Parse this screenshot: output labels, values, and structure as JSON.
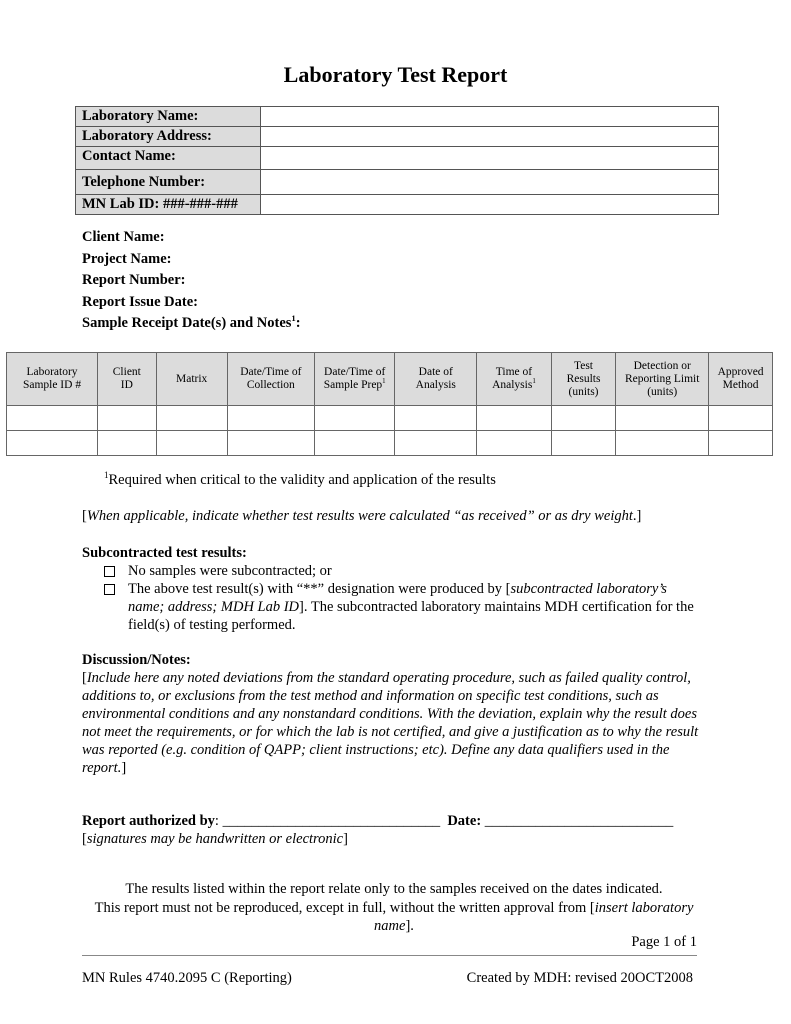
{
  "title": "Laboratory Test Report",
  "lab_info": [
    {
      "label": "Laboratory Name:",
      "value": ""
    },
    {
      "label": "Laboratory Address:",
      "value": ""
    },
    {
      "label": "Contact Name:",
      "value": ""
    },
    {
      "label": "Telephone Number:",
      "value": ""
    },
    {
      "label": "MN Lab ID: ###-###-###",
      "value": ""
    }
  ],
  "fields": {
    "client_name": "Client Name:",
    "project_name": "Project Name:",
    "report_number": "Report Number:",
    "report_issue_date": "Report Issue Date:",
    "sample_receipt": "Sample Receipt Date(s) and Notes",
    "sample_receipt_sup": "1",
    "sample_receipt_colon": ":"
  },
  "samples_table": {
    "headers": [
      {
        "l1": "Laboratory",
        "l2": "Sample ID #",
        "l3": "",
        "sup": ""
      },
      {
        "l1": "Client",
        "l2": "ID",
        "l3": "",
        "sup": ""
      },
      {
        "l1": "Matrix",
        "l2": "",
        "l3": "",
        "sup": ""
      },
      {
        "l1": "Date/Time of",
        "l2": "Collection",
        "l3": "",
        "sup": ""
      },
      {
        "l1": "Date/Time of",
        "l2": "Sample Prep",
        "l3": "",
        "sup": "1"
      },
      {
        "l1": "Date of",
        "l2": "Analysis",
        "l3": "",
        "sup": ""
      },
      {
        "l1": "Time of",
        "l2": "Analysis",
        "l3": "",
        "sup": "1"
      },
      {
        "l1": "Test",
        "l2": "Results",
        "l3": "(units)",
        "sup": ""
      },
      {
        "l1": "Detection or",
        "l2": "Reporting Limit",
        "l3": "(units)",
        "sup": ""
      },
      {
        "l1": "Approved",
        "l2": "Method",
        "l3": "",
        "sup": ""
      }
    ],
    "rows": [
      [
        "",
        "",
        "",
        "",
        "",
        "",
        "",
        "",
        "",
        ""
      ],
      [
        "",
        "",
        "",
        "",
        "",
        "",
        "",
        "",
        "",
        ""
      ]
    ]
  },
  "footnote": {
    "marker": "1",
    "text": "Required when critical to the validity and application of the results"
  },
  "applicability_note": {
    "open": "[",
    "italic": "When applicable, indicate whether test results were calculated “as received” or as dry weight",
    "close": ".]"
  },
  "subcontracted": {
    "heading": "Subcontracted test results:",
    "options": [
      {
        "checked": false,
        "text_before": "No samples were subcontracted; or",
        "italic": "",
        "text_after": ""
      },
      {
        "checked": false,
        "text_before": "The above test result(s) with “**” designation were produced by [",
        "italic": "subcontracted laboratory’s name; address; MDH Lab ID",
        "text_after": "]. The subcontracted laboratory maintains MDH certification for the field(s) of testing performed."
      }
    ]
  },
  "discussion": {
    "heading": "Discussion/Notes:",
    "open": "[",
    "italic": "Include here any noted deviations from the standard operating procedure, such as failed quality control, additions to, or exclusions from the test method and information on specific test conditions, such as environmental conditions and any nonstandard conditions.  With the deviation, explain why the result does not meet the requirements, or for which the lab is not certified, and give a justification as to why the result was reported (e.g. condition of QAPP; client instructions; etc).  Define any data qualifiers used in the report.",
    "close": "]"
  },
  "authorization": {
    "label": "Report authorized by",
    "colon": ": ",
    "signature_line": "______________________________",
    "date_label": "Date:",
    "date_line": " __________________________",
    "note_open": "[",
    "note_italic": "signatures may be handwritten or electronic",
    "note_close": "]"
  },
  "disclaimer": {
    "line1": "The results listed within the report relate only to the samples received on the dates indicated.",
    "line2_before": "This report must not be reproduced, except in full, without the written approval from [",
    "line2_italic": "insert laboratory name",
    "line2_after": "]."
  },
  "page_number": "Page 1 of 1",
  "footer": {
    "left": "MN Rules 4740.2095 C (Reporting)",
    "right": "Created by MDH: revised 20OCT2008"
  }
}
